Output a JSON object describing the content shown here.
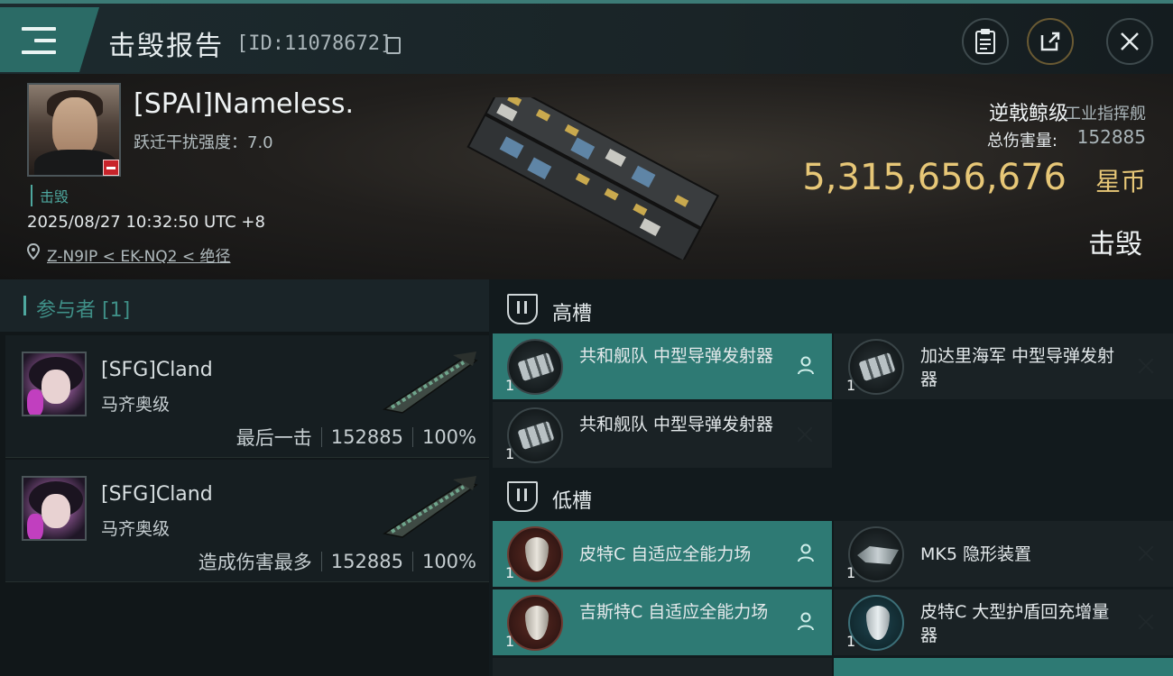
{
  "header": {
    "title": "击毁报告",
    "id_text": "[ID:11078672]"
  },
  "victim": {
    "name": "[SPAI]Nameless.",
    "warp_scramble": "跃迁干扰强度：7.0",
    "tag": "击毁",
    "time": "2025/08/27 10:32:50 UTC +8",
    "location": "Z-N9IP < EK-NQ2 < 绝径",
    "ship_name": "逆戟鲸级",
    "ship_class": "工业指挥舰",
    "total_damage_label": "总伤害量:",
    "total_damage_value": "152885",
    "isk_value": "5,315,656,676",
    "isk_unit": "星币",
    "status": "击毁"
  },
  "participants": {
    "header": "参与者 [1]",
    "items": [
      {
        "name": "[SFG]Cland",
        "ship": "马齐奥级",
        "role": "最后一击",
        "damage": "152885",
        "percent": "100%"
      },
      {
        "name": "[SFG]Cland",
        "ship": "马齐奥级",
        "role": "造成伤害最多",
        "damage": "152885",
        "percent": "100%"
      }
    ]
  },
  "fitting": {
    "high_label": "高槽",
    "low_label": "低槽",
    "high": [
      {
        "name": "共和舰队 中型导弹发射器",
        "qty": "1",
        "state": "dropped"
      },
      {
        "name": "加达里海军 中型导弹发射器",
        "qty": "1",
        "state": "destroyed"
      },
      {
        "name": "共和舰队 中型导弹发射器",
        "qty": "1",
        "state": "destroyed"
      }
    ],
    "low": [
      {
        "name": "皮特C 自适应全能力场",
        "qty": "1",
        "state": "dropped"
      },
      {
        "name": "MK5 隐形装置",
        "qty": "1",
        "state": "destroyed"
      },
      {
        "name": "吉斯特C 自适应全能力场",
        "qty": "1",
        "state": "dropped"
      },
      {
        "name": "皮特C 大型护盾回充增量器",
        "qty": "1",
        "state": "destroyed"
      }
    ]
  },
  "colors": {
    "accent": "#2e7a74",
    "isk": "#e7c777",
    "badge": "#c8242b"
  },
  "icons": [
    "menu-icon",
    "copy-icon",
    "clipboard-icon",
    "share-icon",
    "close-icon",
    "location-pin-icon",
    "person-icon",
    "x-icon"
  ]
}
